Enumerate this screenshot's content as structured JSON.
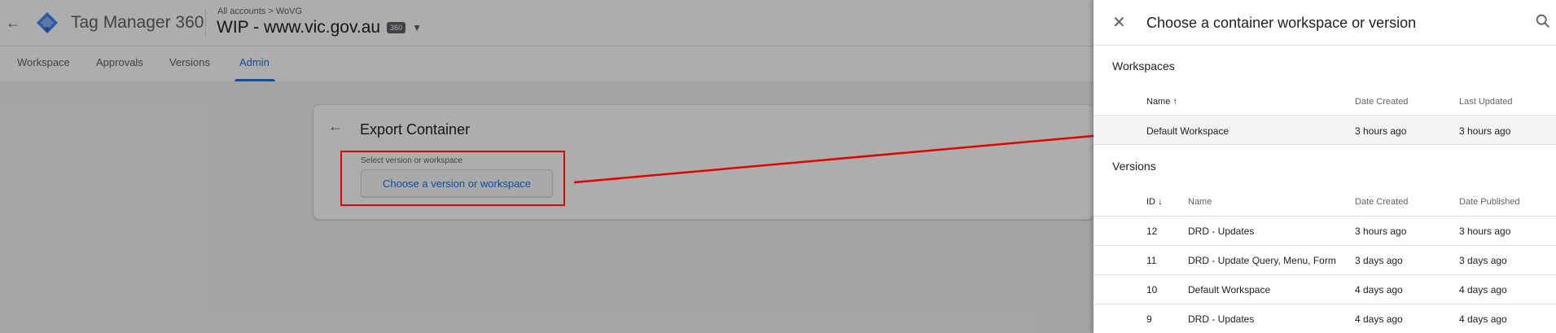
{
  "app": {
    "product_name": "Tag Manager 360",
    "breadcrumb": "All accounts > WoVG",
    "container_name": "WIP - www.vic.gov.au",
    "container_badge": "360",
    "nav_tabs": [
      "Workspace",
      "Approvals",
      "Versions",
      "Admin"
    ],
    "active_tab": "Admin"
  },
  "export_card": {
    "title": "Export Container",
    "field_label": "Select version or workspace",
    "choose_button": "Choose a version or workspace"
  },
  "panel": {
    "title": "Choose a container workspace or version",
    "workspaces": {
      "title": "Workspaces",
      "columns": [
        "Name",
        "Date Created",
        "Last Updated"
      ],
      "sort_indicator": "↑",
      "rows": [
        {
          "name": "Default Workspace",
          "date_created": "3 hours ago",
          "last_updated": "3 hours ago"
        }
      ]
    },
    "versions": {
      "title": "Versions",
      "columns": [
        "ID",
        "Name",
        "Date Created",
        "Date Published"
      ],
      "sort_indicator": "↓",
      "rows": [
        {
          "id": "12",
          "name": "DRD - Updates",
          "date_created": "3 hours ago",
          "date_published": "3 hours ago"
        },
        {
          "id": "11",
          "name": "DRD - Update Query, Menu, Form",
          "date_created": "3 days ago",
          "date_published": "3 days ago"
        },
        {
          "id": "10",
          "name": "Default Workspace",
          "date_created": "4 days ago",
          "date_published": "4 days ago"
        },
        {
          "id": "9",
          "name": "DRD - Updates",
          "date_created": "4 days ago",
          "date_published": "4 days ago"
        }
      ]
    }
  },
  "colors": {
    "accent": "#1a73e8",
    "annotation": "#e00000"
  }
}
